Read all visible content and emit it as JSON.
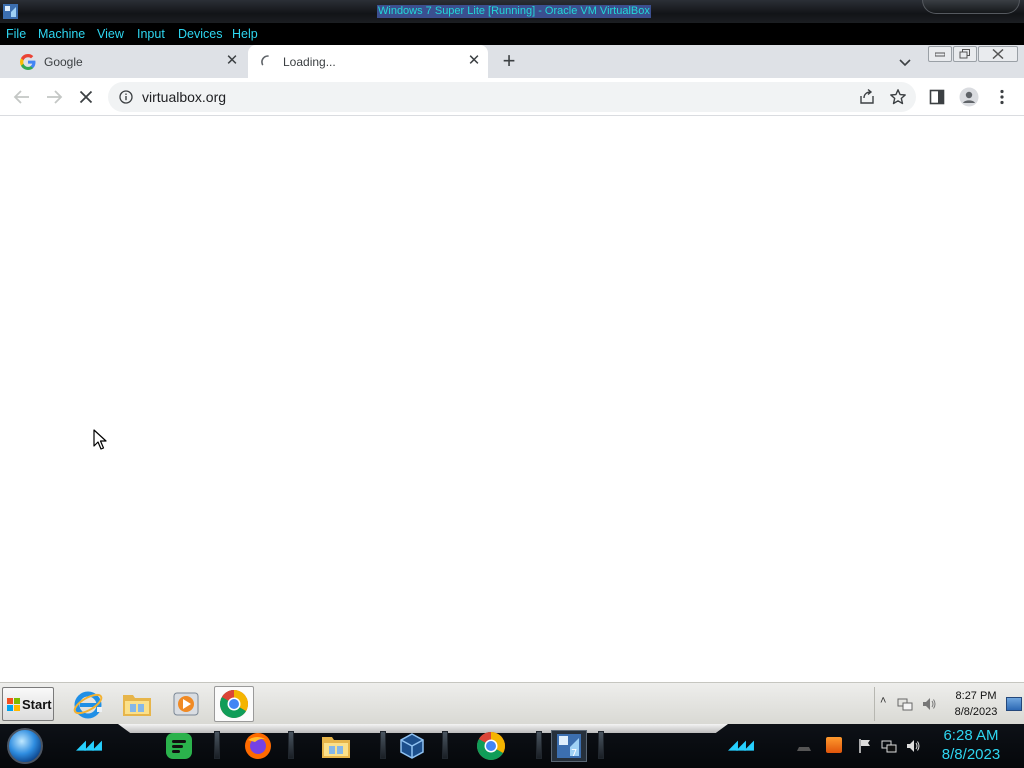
{
  "host_window": {
    "title": "Windows 7 Super Lite [Running] - Oracle VM VirtualBox",
    "menu": [
      "File",
      "Machine",
      "View",
      "Input",
      "Devices",
      "Help"
    ]
  },
  "browser": {
    "tabs": [
      {
        "label": "Google",
        "icon": "google-g-icon"
      },
      {
        "label": "Loading...",
        "icon": "loading-spinner-icon",
        "active": true
      }
    ],
    "url": "virtualbox.org",
    "toolbar_icons": [
      "back-arrow-icon",
      "forward-arrow-icon",
      "stop-loading-icon",
      "info-icon",
      "share-icon",
      "star-icon",
      "side-panel-icon",
      "profile-icon",
      "kebab-menu-icon"
    ]
  },
  "guest_taskbar": {
    "start_label": "Start",
    "pinned": [
      "internet-explorer-icon",
      "file-explorer-icon",
      "media-player-icon",
      "chrome-icon"
    ],
    "clock_time": "8:27 PM",
    "clock_date": "8/8/2023"
  },
  "host_taskbar": {
    "apps": [
      "feedly-icon",
      "firefox-icon",
      "file-explorer-icon",
      "virtualbox-icon",
      "chrome-icon",
      "windows7-vm-icon"
    ],
    "clock_time": "6:28 AM",
    "clock_date": "8/8/2023"
  },
  "colors": {
    "vb_menu_text": "#2ed6f0",
    "chrome_tabstrip": "#dee1e6",
    "host_clock": "#2ed6f0"
  }
}
